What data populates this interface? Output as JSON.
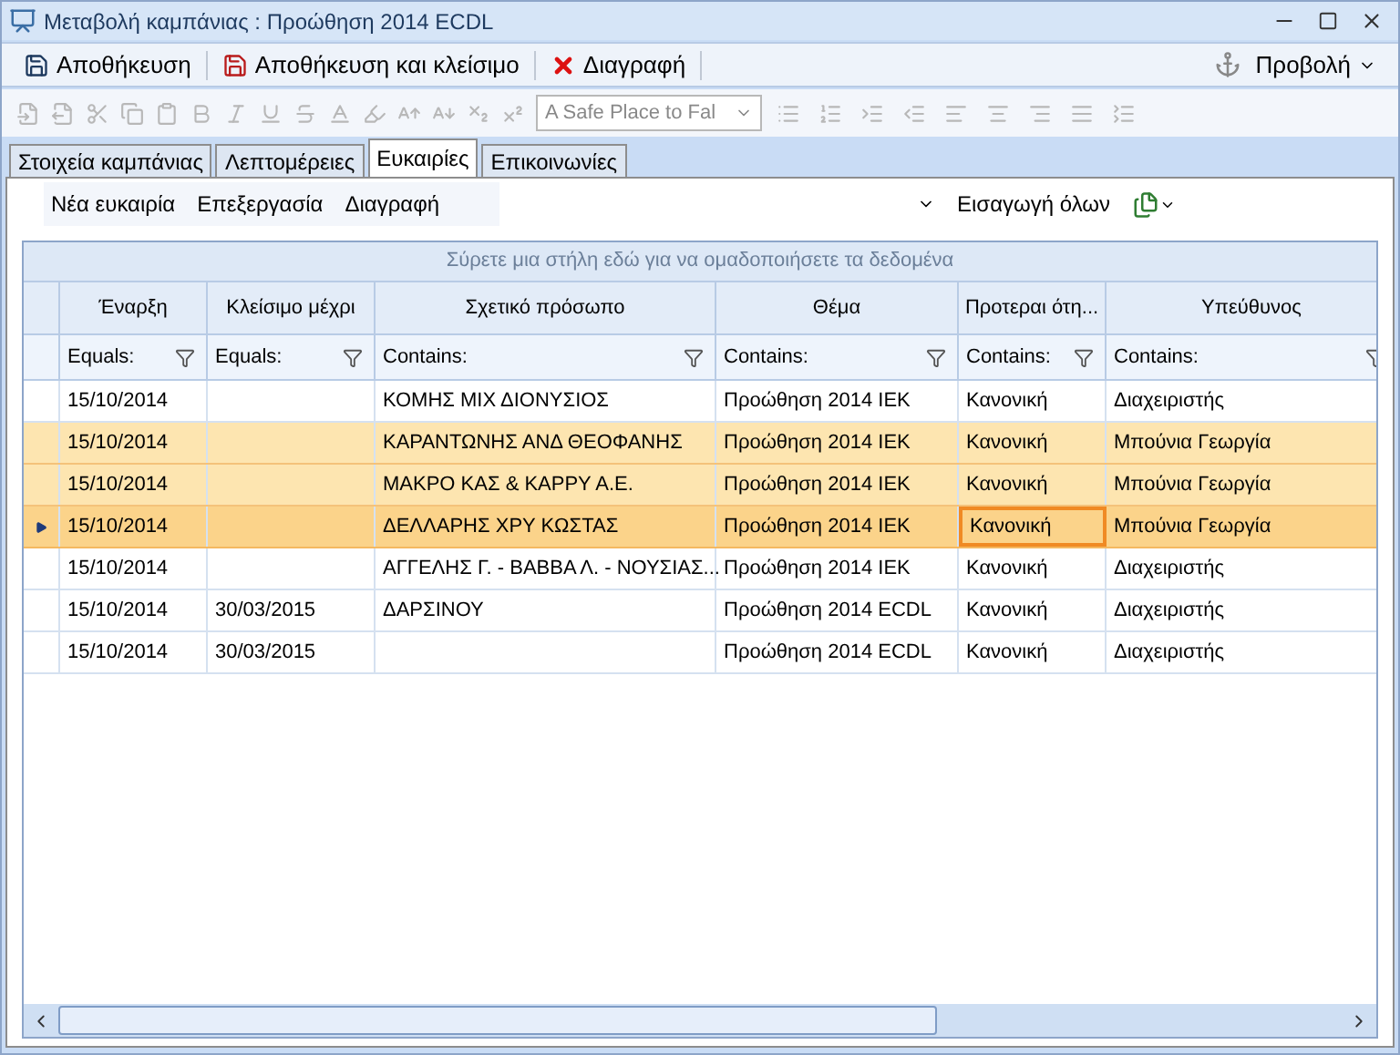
{
  "window": {
    "title": "Μεταβολή καμπάνιας : Προώθηση 2014 ECDL"
  },
  "toolbar": {
    "buttons": [
      {
        "label": "Αποθήκευση",
        "kind": "save"
      },
      {
        "label": "Αποθήκευση και κλείσιμο",
        "kind": "saveclose"
      },
      {
        "label": "Διαγραφή",
        "kind": "delete"
      }
    ],
    "view_menu": "Προβολή"
  },
  "format_bar": {
    "disabled": true,
    "font": "A Safe Place to Fal"
  },
  "tabs": [
    {
      "label": "Στοιχεία καμπάνιας",
      "selected": false
    },
    {
      "label": "Λεπτομέρειες",
      "selected": false
    },
    {
      "label": "Ευκαιρίες",
      "selected": true
    },
    {
      "label": "Επικοινωνίες",
      "selected": false
    }
  ],
  "sub_toolbar": {
    "buttons": [
      "Νέα ευκαιρία",
      "Επεξεργασία",
      "Διαγραφή"
    ],
    "import_all": "Εισαγωγή όλων"
  },
  "grid": {
    "group_panel": "Σύρετε μια στήλη εδώ για να ομαδοποιήσετε τα δεδομένα",
    "columns": [
      {
        "title": "Έναρξη",
        "filter": "Equals:",
        "focused": false
      },
      {
        "title": "Κλείσιμο μέχρι",
        "filter": "Equals:",
        "focused": false
      },
      {
        "title": "Σχετικό πρόσωπο",
        "filter": "Contains:",
        "focused": false
      },
      {
        "title": "Θέμα",
        "filter": "Contains:",
        "focused": false
      },
      {
        "title": "Προτεραι ότη...",
        "filter": "Contains:",
        "focused": true
      },
      {
        "title": "Υπεύθυνος",
        "filter": "Contains:",
        "focused": false
      }
    ],
    "rows": [
      {
        "cells": [
          "15/10/2014",
          "",
          "ΚΟΜΗΣ ΜΙΧ ΔΙΟΝΥΣΙΟΣ",
          "Προώθηση 2014 ΙΕΚ",
          "Κανονική",
          "Διαχειριστής"
        ],
        "selected": false,
        "current": false
      },
      {
        "cells": [
          "15/10/2014",
          "",
          "ΚΑΡΑΝΤΩΝΗΣ ΑΝΔ ΘΕΟΦΑΝΗΣ",
          "Προώθηση 2014 ΙΕΚ",
          "Κανονική",
          "Μπούνια Γεωργία"
        ],
        "selected": true,
        "current": false
      },
      {
        "cells": [
          "15/10/2014",
          "",
          "ΜΑΚΡΟ ΚΑΣ & ΚΑΡΡΥ Α.Ε.",
          "Προώθηση 2014 ΙΕΚ",
          "Κανονική",
          "Μπούνια Γεωργία"
        ],
        "selected": true,
        "current": false
      },
      {
        "cells": [
          "15/10/2014",
          "",
          "ΔΕΛΛΑΡΗΣ ΧΡΥ ΚΩΣΤΑΣ",
          "Προώθηση 2014 ΙΕΚ",
          "Κανονική",
          "Μπούνια Γεωργία"
        ],
        "selected": true,
        "current": true
      },
      {
        "cells": [
          "15/10/2014",
          "",
          "ΑΓΓΕΛΗΣ Γ. - ΒΑΒΒΑ Λ. - ΝΟΥΣΙΑΣ...",
          "Προώθηση 2014 ΙΕΚ",
          "Κανονική",
          "Διαχειριστής"
        ],
        "selected": false,
        "current": false
      },
      {
        "cells": [
          "15/10/2014",
          "30/03/2015",
          "ΔΑΡΣΙΝΟΥ",
          "Προώθηση 2014 ECDL",
          "Κανονική",
          "Διαχειριστής"
        ],
        "selected": false,
        "current": false
      },
      {
        "cells": [
          "15/10/2014",
          "30/03/2015",
          "",
          "Προώθηση 2014 ECDL",
          "Κανονική",
          "Διαχειριστής"
        ],
        "selected": false,
        "current": false
      }
    ]
  }
}
